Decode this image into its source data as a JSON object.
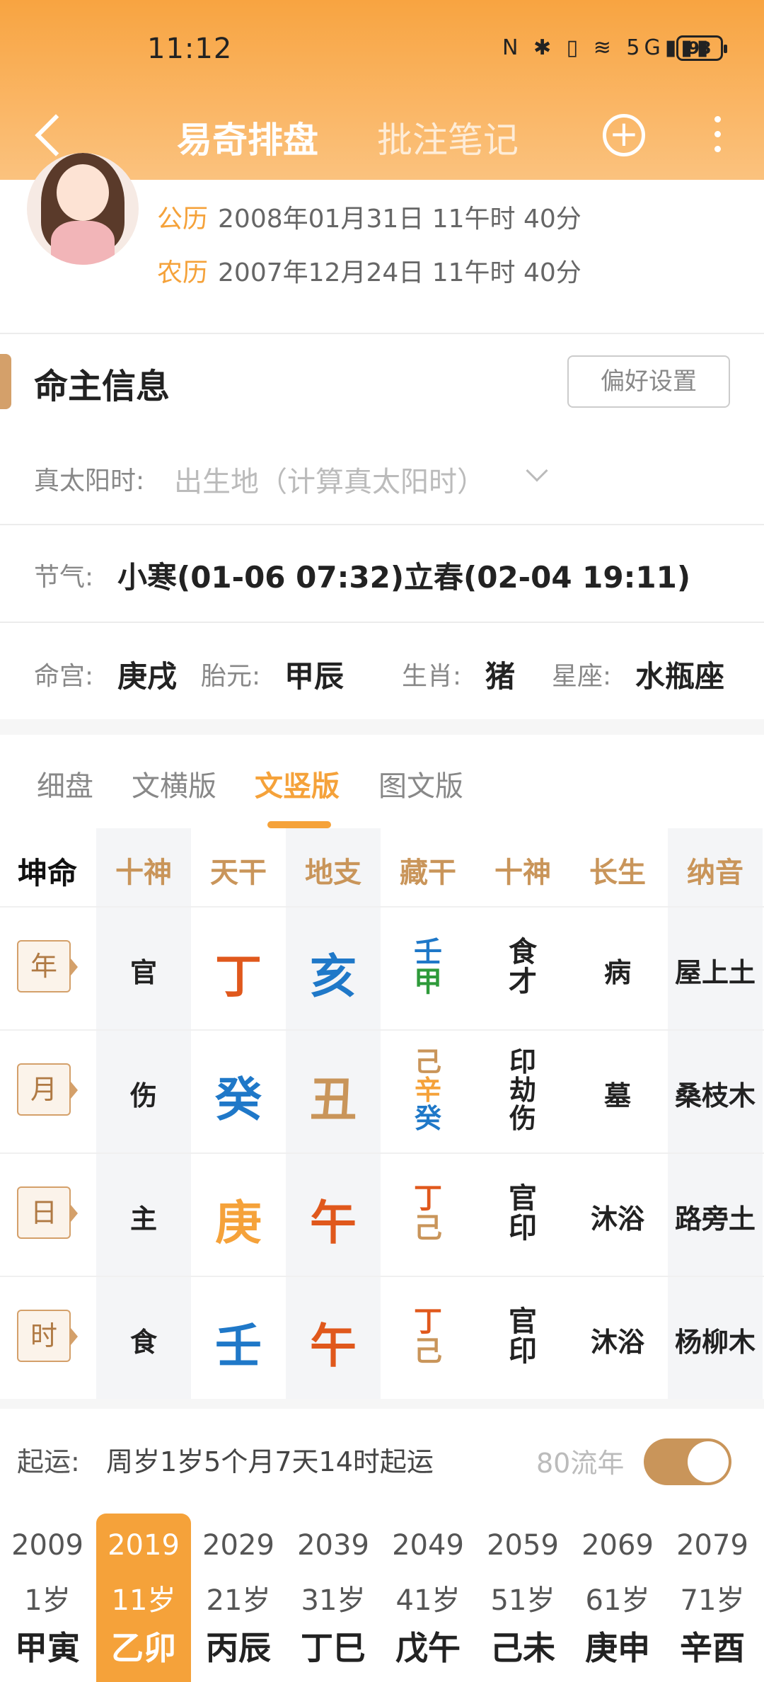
{
  "status": {
    "time": "11:12",
    "icons": "N ✱ ▯ ≋ 5G▮▮▮",
    "battery": "93"
  },
  "nav": {
    "title": "易奇排盘",
    "tab2": "批注笔记"
  },
  "profile": {
    "solar_label": "公历",
    "solar_value": "2008年01月31日 11午时 40分",
    "lunar_label": "农历",
    "lunar_value": "2007年12月24日 11午时 40分"
  },
  "section": {
    "title": "命主信息",
    "pref_button": "偏好设置"
  },
  "info": {
    "solar_time_label": "真太阳时:",
    "solar_time_placeholder": "出生地（计算真太阳时）",
    "jieqi_label": "节气:",
    "jieqi_value": "小寒(01-06 07:32)立春(02-04 19:11)",
    "minggong_label": "命宫:",
    "minggong_value": "庚戌",
    "taiyuan_label": "胎元:",
    "taiyuan_value": "甲辰",
    "shengxiao_label": "生肖:",
    "shengxiao_value": "猪",
    "xingzuo_label": "星座:",
    "xingzuo_value": "水瓶座"
  },
  "tabs": [
    "细盘",
    "文横版",
    "文竖版",
    "图文版"
  ],
  "grid": {
    "corner": "坤命",
    "headers": [
      "十神",
      "天干",
      "地支",
      "藏干",
      "十神",
      "长生",
      "纳音"
    ],
    "rows": [
      {
        "pillar": "年",
        "shishen": "官",
        "tiangan": "丁",
        "dizhi": "亥",
        "canggan": [
          "壬",
          "甲"
        ],
        "shishen2": [
          "食",
          "才"
        ],
        "changsheng": "病",
        "nayin": "屋上土"
      },
      {
        "pillar": "月",
        "shishen": "伤",
        "tiangan": "癸",
        "dizhi": "丑",
        "canggan": [
          "己",
          "辛",
          "癸"
        ],
        "shishen2": [
          "印",
          "劫",
          "伤"
        ],
        "changsheng": "墓",
        "nayin": "桑枝木"
      },
      {
        "pillar": "日",
        "shishen": "主",
        "tiangan": "庚",
        "dizhi": "午",
        "canggan": [
          "丁",
          "己"
        ],
        "shishen2": [
          "官",
          "印"
        ],
        "changsheng": "沐浴",
        "nayin": "路旁土"
      },
      {
        "pillar": "时",
        "shishen": "食",
        "tiangan": "壬",
        "dizhi": "午",
        "canggan": [
          "丁",
          "己"
        ],
        "shishen2": [
          "官",
          "印"
        ],
        "changsheng": "沐浴",
        "nayin": "杨柳木"
      }
    ]
  },
  "colors": {
    "fire": "#e0581c",
    "water": "#1f78c8",
    "earth": "#c9955a",
    "metal": "#f5a23a",
    "wood": "#2e9a3a",
    "accent": "#f5a23a"
  },
  "qiyun": {
    "label": "起运:",
    "value": "周岁1岁5个月7天14时起运",
    "liunian_label": "80流年"
  },
  "dayun": [
    {
      "year": "2009",
      "age": "1岁",
      "gz": "甲寅"
    },
    {
      "year": "2019",
      "age": "11岁",
      "gz": "乙卯"
    },
    {
      "year": "2029",
      "age": "21岁",
      "gz": "丙辰"
    },
    {
      "year": "2039",
      "age": "31岁",
      "gz": "丁巳"
    },
    {
      "year": "2049",
      "age": "41岁",
      "gz": "戊午"
    },
    {
      "year": "2059",
      "age": "51岁",
      "gz": "己未"
    },
    {
      "year": "2069",
      "age": "61岁",
      "gz": "庚申"
    },
    {
      "year": "2079",
      "age": "71岁",
      "gz": "辛酉"
    }
  ]
}
